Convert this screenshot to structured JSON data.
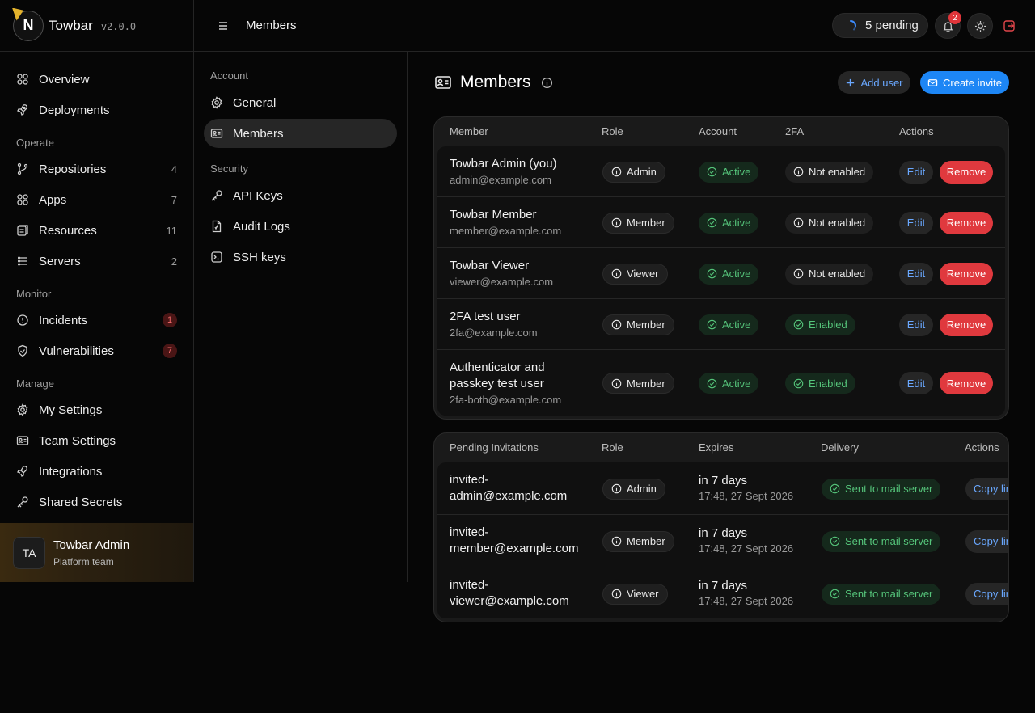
{
  "brand": {
    "name": "Towbar",
    "version": "v2.0.0",
    "logo_letter": "N"
  },
  "sidebar": {
    "top_items": [
      {
        "label": "Overview",
        "icon": "grid-icon"
      },
      {
        "label": "Deployments",
        "icon": "rocket-icon"
      }
    ],
    "sections": [
      {
        "title": "Operate",
        "items": [
          {
            "label": "Repositories",
            "count": "4",
            "icon": "git-branch-icon"
          },
          {
            "label": "Apps",
            "count": "7",
            "icon": "grid-icon"
          },
          {
            "label": "Resources",
            "count": "11",
            "icon": "database-icon"
          },
          {
            "label": "Servers",
            "count": "2",
            "icon": "server-icon"
          }
        ]
      },
      {
        "title": "Monitor",
        "items": [
          {
            "label": "Incidents",
            "count": "1",
            "icon": "alert-circle-icon"
          },
          {
            "label": "Vulnerabilities",
            "count": "7",
            "icon": "shield-icon"
          }
        ]
      },
      {
        "title": "Manage",
        "items": [
          {
            "label": "My Settings",
            "icon": "gear-icon"
          },
          {
            "label": "Team Settings",
            "icon": "id-card-icon"
          },
          {
            "label": "Integrations",
            "icon": "plug-icon"
          },
          {
            "label": "Shared Secrets",
            "icon": "key-icon"
          }
        ]
      }
    ],
    "user": {
      "initials": "TA",
      "name": "Towbar Admin",
      "team": "Platform team"
    }
  },
  "topbar": {
    "title": "Members",
    "pending_label": "5 pending",
    "notification_count": "2"
  },
  "subnav": {
    "account_title": "Account",
    "general": "General",
    "members": "Members",
    "security_title": "Security",
    "api_keys": "API Keys",
    "audit_logs": "Audit Logs",
    "ssh_keys": "SSH keys"
  },
  "page": {
    "title": "Members",
    "add_user": "Add user",
    "create_invite": "Create invite"
  },
  "members_table": {
    "headers": {
      "member": "Member",
      "role": "Role",
      "account": "Account",
      "twofa": "2FA",
      "actions": "Actions"
    },
    "edit_label": "Edit",
    "remove_label": "Remove",
    "rows": [
      {
        "name": "Towbar Admin (you)",
        "email": "admin@example.com",
        "role": "Admin",
        "account": "Active",
        "twofa": "Not enabled",
        "twofa_enabled": false
      },
      {
        "name": "Towbar Member",
        "email": "member@example.com",
        "role": "Member",
        "account": "Active",
        "twofa": "Not enabled",
        "twofa_enabled": false
      },
      {
        "name": "Towbar Viewer",
        "email": "viewer@example.com",
        "role": "Viewer",
        "account": "Active",
        "twofa": "Not enabled",
        "twofa_enabled": false
      },
      {
        "name": "2FA test user",
        "email": "2fa@example.com",
        "role": "Member",
        "account": "Active",
        "twofa": "Enabled",
        "twofa_enabled": true
      },
      {
        "name": "Authenticator and passkey test user",
        "email": "2fa-both@example.com",
        "role": "Member",
        "account": "Active",
        "twofa": "Enabled",
        "twofa_enabled": true
      }
    ]
  },
  "invitations_table": {
    "headers": {
      "pending": "Pending Invitations",
      "role": "Role",
      "expires": "Expires",
      "delivery": "Delivery",
      "actions": "Actions"
    },
    "copy_label": "Copy link",
    "rows": [
      {
        "email_line1": "invited-",
        "email_line2": "admin@example.com",
        "role": "Admin",
        "expires": "in 7 days",
        "expires_at": "17:48, 27 Sept 2026",
        "delivery": "Sent to mail server"
      },
      {
        "email_line1": "invited-",
        "email_line2": "member@example.com",
        "role": "Member",
        "expires": "in 7 days",
        "expires_at": "17:48, 27 Sept 2026",
        "delivery": "Sent to mail server"
      },
      {
        "email_line1": "invited-",
        "email_line2": "viewer@example.com",
        "role": "Viewer",
        "expires": "in 7 days",
        "expires_at": "17:48, 27 Sept 2026",
        "delivery": "Sent to mail server"
      }
    ]
  },
  "colors": {
    "accent": "#1d86f5",
    "danger": "#e0393e",
    "success": "#55c47a",
    "link": "#6aa8ff"
  }
}
